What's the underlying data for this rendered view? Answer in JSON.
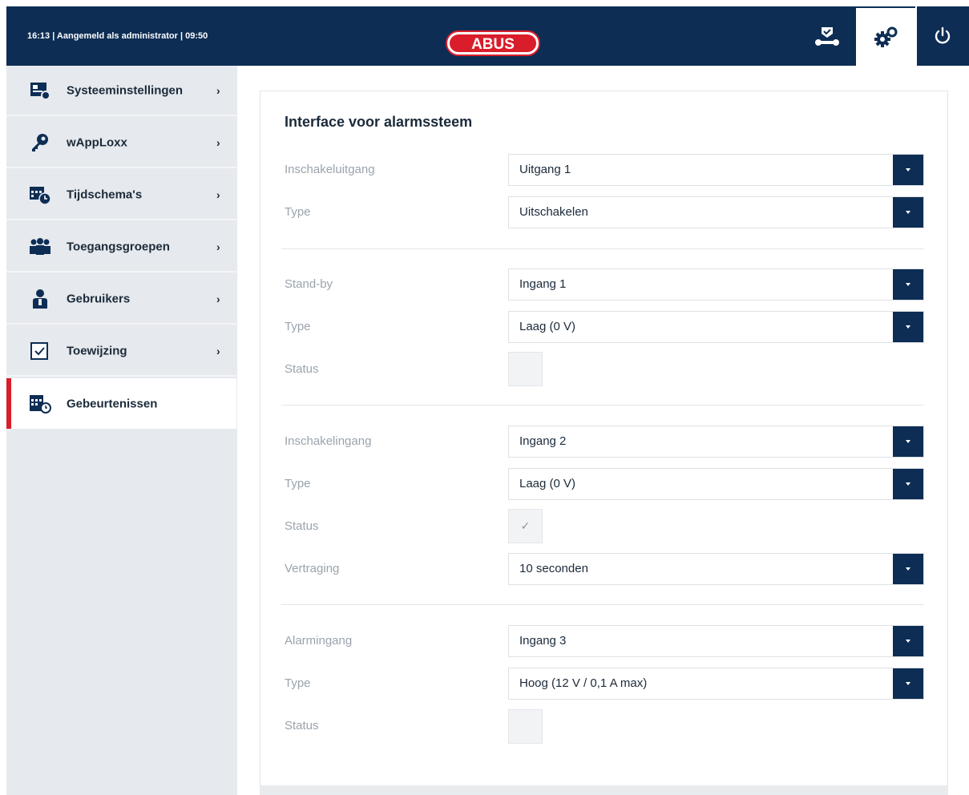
{
  "header": {
    "session_info": "16:13 | Aangemeld als administrator | 09:50",
    "logo_text": "ABUS",
    "colors": {
      "bar": "#0d2d54",
      "logo_red": "#d91d2a"
    },
    "buttons": [
      {
        "icon": "devices-icon"
      },
      {
        "icon": "settings-gears-icon",
        "active": true
      },
      {
        "icon": "power-icon"
      }
    ]
  },
  "sidebar": {
    "items": [
      {
        "label": "Systeeminstellingen",
        "icon": "system-settings-icon",
        "chevron": "›"
      },
      {
        "label": "wAppLoxx",
        "icon": "key-icon",
        "chevron": "›"
      },
      {
        "label": "Tijdschema's",
        "icon": "calendar-clock-icon",
        "chevron": "›"
      },
      {
        "label": "Toegangsgroepen",
        "icon": "group-icon",
        "chevron": "›"
      },
      {
        "label": "Gebruikers",
        "icon": "user-icon",
        "chevron": "›"
      },
      {
        "label": "Toewijzing",
        "icon": "checkbox-icon",
        "chevron": "›"
      },
      {
        "label": "Gebeurtenissen",
        "icon": "events-calendar-icon",
        "active": true
      }
    ],
    "active_color": "#d91d2a"
  },
  "main": {
    "title": "Interface voor alarmssteem",
    "fields": {
      "inschakeluitgang": {
        "label": "Inschakeluitgang",
        "value": "Uitgang 1"
      },
      "type1": {
        "label": "Type",
        "value": "Uitschakelen"
      },
      "standby": {
        "label": "Stand-by",
        "value": "Ingang 1"
      },
      "type2": {
        "label": "Type",
        "value": "Laag (0 V)"
      },
      "status1": {
        "label": "Status",
        "checked": false
      },
      "inschakelingang": {
        "label": "Inschakelingang",
        "value": "Ingang 2"
      },
      "type3": {
        "label": "Type",
        "value": "Laag (0 V)"
      },
      "status2": {
        "label": "Status",
        "checked": true,
        "mark": "✓"
      },
      "vertraging": {
        "label": "Vertraging",
        "value": "10 seconden"
      },
      "alarmingang": {
        "label": "Alarmingang",
        "value": "Ingang 3"
      },
      "type4": {
        "label": "Type",
        "value": "Hoog (12 V / 0,1 A max)"
      },
      "status3": {
        "label": "Status",
        "checked": false
      }
    }
  }
}
